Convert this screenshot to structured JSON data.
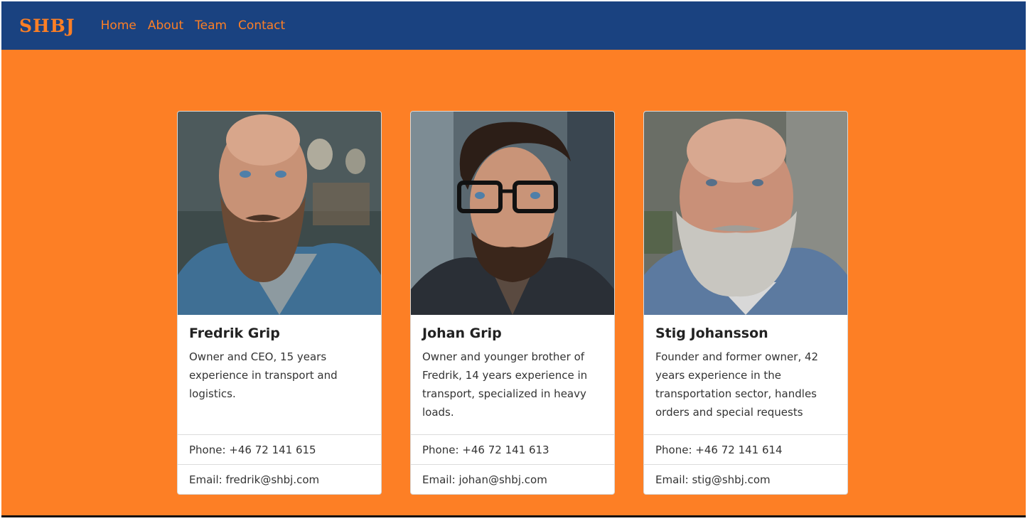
{
  "navbar": {
    "brand": "SHBJ",
    "links": [
      "Home",
      "About",
      "Team",
      "Contact"
    ]
  },
  "team": [
    {
      "name": "Fredrik Grip",
      "description": "Owner and CEO, 15 years experience in transport and logistics.",
      "phone": "Phone: +46 72 141 615",
      "email": "Email: fredrik@shbj.com"
    },
    {
      "name": "Johan Grip",
      "description": "Owner and younger brother of Fredrik, 14 years experience in transport, specialized in heavy loads.",
      "phone": "Phone: +46 72 141 613",
      "email": "Email: johan@shbj.com"
    },
    {
      "name": "Stig Johansson",
      "description": "Founder and former owner, 42 years experience in the transportation sector, handles orders and special requests",
      "phone": "Phone: +46 72 141 614",
      "email": "Email: stig@shbj.com"
    }
  ],
  "colors": {
    "navbar": "#1a4280",
    "accent": "#fd7f25",
    "card": "#ffffff"
  }
}
